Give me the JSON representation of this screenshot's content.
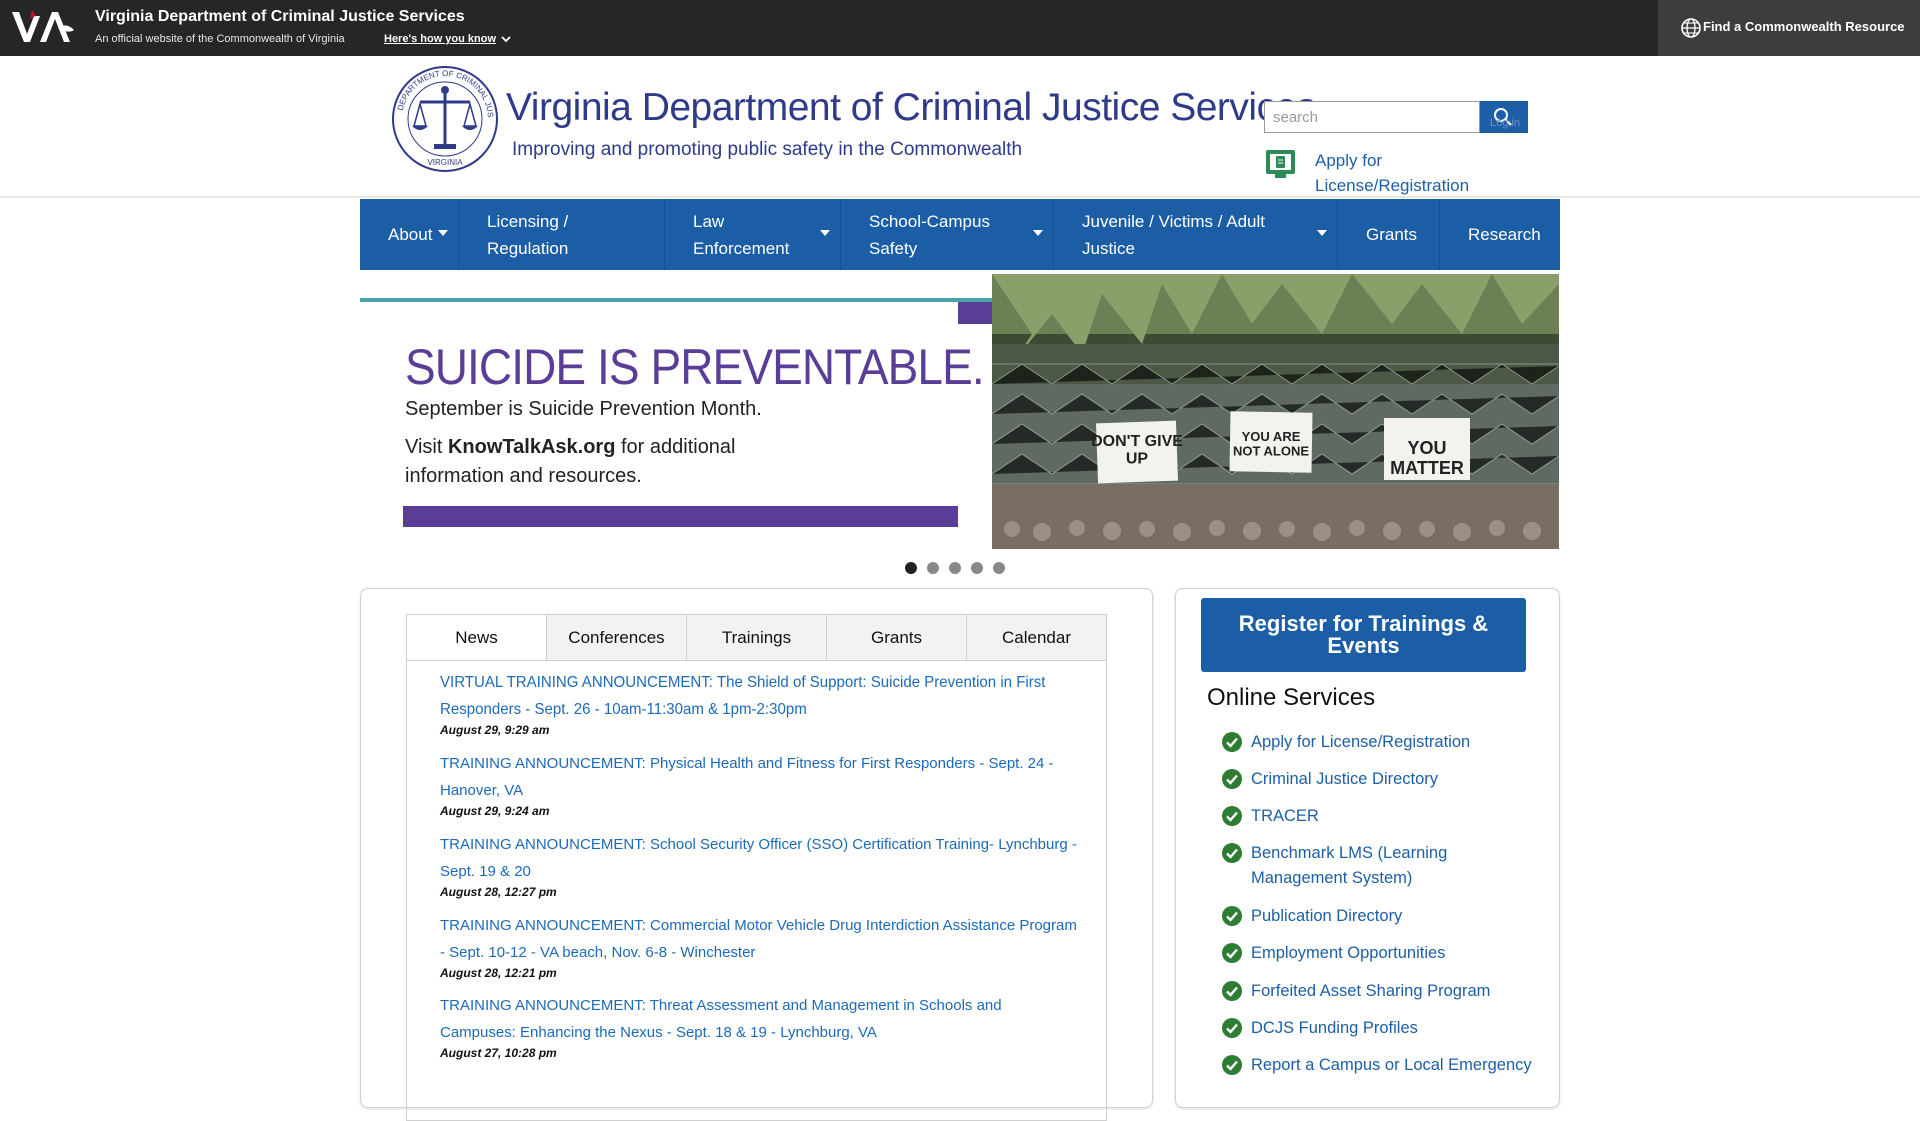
{
  "commonwealth_bar": {
    "title": "Virginia Department of Criminal Justice Services",
    "subtitle": "An official website of the Commonwealth of Virginia",
    "how_link": "Here's how you know",
    "find_resource": "Find a Commonwealth Resource"
  },
  "header": {
    "agency_title": "Virginia Department of Criminal Justice Services",
    "tagline": "Improving and promoting public safety in the Commonwealth",
    "search_placeholder": "search",
    "login_hint": "Log in",
    "apply_link": "Apply for License/Registration"
  },
  "nav": {
    "items": [
      {
        "label": "About",
        "has_dropdown": true
      },
      {
        "label": "Licensing / Regulation",
        "has_dropdown": false
      },
      {
        "label": "Law Enforcement",
        "has_dropdown": true
      },
      {
        "label": "School-Campus Safety",
        "has_dropdown": true
      },
      {
        "label": "Juvenile / Victims / Adult Justice",
        "has_dropdown": true
      },
      {
        "label": "Grants",
        "has_dropdown": false
      },
      {
        "label": "Research",
        "has_dropdown": false
      }
    ]
  },
  "banner": {
    "headline": "SUICIDE IS PREVENTABLE.",
    "line1": "September is Suicide Prevention Month.",
    "line2_prefix": "Visit ",
    "line2_bold": "KnowTalkAsk.org",
    "line2_suffix": " for additional",
    "line3": "information and resources.",
    "signs": [
      "DON'T GIVE UP",
      "YOU ARE NOT ALONE",
      "YOU MATTER"
    ],
    "slide_count": 5,
    "active_slide": 1
  },
  "tabs": [
    "News",
    "Conferences",
    "Trainings",
    "Grants",
    "Calendar"
  ],
  "news": [
    {
      "title": "VIRTUAL TRAINING ANNOUNCEMENT: The Shield of Support: Suicide Prevention in First Responders - Sept. 26 - 10am-11:30am & 1pm-2:30pm",
      "date": "August 29, 9:29 am"
    },
    {
      "title": "TRAINING ANNOUNCEMENT: Physical Health and Fitness for First Responders - Sept. 24 - Hanover, VA",
      "date": "August 29, 9:24 am"
    },
    {
      "title": "TRAINING ANNOUNCEMENT: School Security Officer (SSO) Certification Training- Lynchburg - Sept. 19 & 20",
      "date": "August 28, 12:27 pm"
    },
    {
      "title": "TRAINING ANNOUNCEMENT: Commercial Motor Vehicle Drug Interdiction Assistance Program - Sept. 10-12 - VA beach, Nov. 6-8 - Winchester",
      "date": "August 28, 12:21 pm"
    },
    {
      "title": "TRAINING ANNOUNCEMENT: Threat Assessment and Management in Schools and Campuses: Enhancing the Nexus - Sept. 18 & 19 - Lynchburg, VA",
      "date": "August 27, 10:28 pm"
    }
  ],
  "sidebar": {
    "register_button": "Register for Trainings & Events",
    "online_services_title": "Online Services",
    "services": [
      "Apply for License/Registration",
      "Criminal Justice Directory",
      "TRACER",
      "Benchmark LMS (Learning Management System)",
      "Publication Directory",
      "Employment Opportunities",
      "Forfeited Asset Sharing Program",
      "DCJS Funding Profiles",
      "Report a Campus or Local Emergency"
    ]
  },
  "colors": {
    "commonwealth_bar": "#262626",
    "nav_blue": "#1b5ea6",
    "link_blue": "#1d6ab8",
    "banner_purple": "#5a3d97",
    "banner_teal": "#4ba3a8",
    "check_green": "#2e7d32"
  }
}
